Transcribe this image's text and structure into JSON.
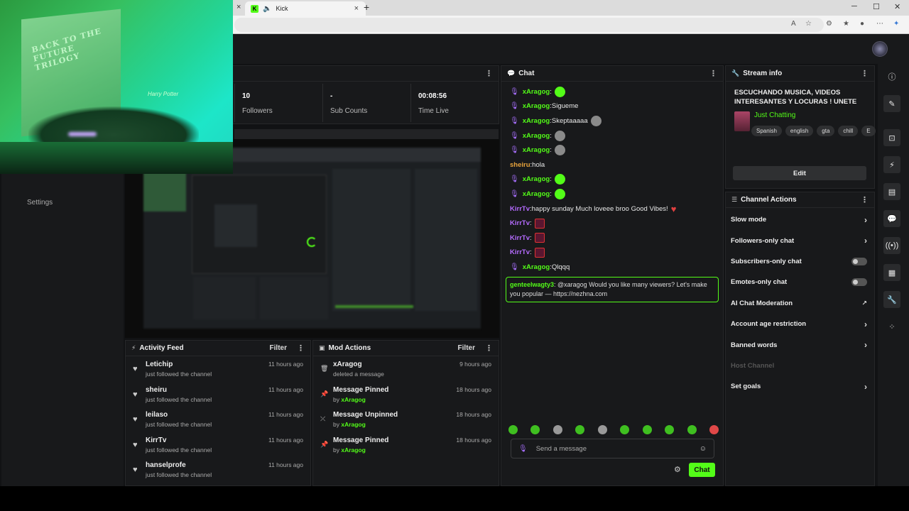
{
  "browser": {
    "tab_title": "Kick",
    "tab_favicon": "K",
    "new_tab": "+",
    "close": "×",
    "min": "─",
    "max": "☐",
    "wclose": "✕"
  },
  "stats": [
    {
      "value": "10",
      "label": "Followers"
    },
    {
      "value": "-",
      "label": "Sub Counts"
    },
    {
      "value": "00:08:56",
      "label": "Time Live"
    }
  ],
  "webcam": {
    "box_text": "BACK TO THE FUTURE TRILOGY",
    "hp_text": "Harry Potter"
  },
  "settings_label": "Settings",
  "activity_feed": {
    "title": "Activity Feed",
    "filter": "Filter",
    "items": [
      {
        "name": "Letichip",
        "sub": "just followed the channel",
        "ago": "11 hours ago"
      },
      {
        "name": "sheiru",
        "sub": "just followed the channel",
        "ago": "11 hours ago"
      },
      {
        "name": "leilaso",
        "sub": "just followed the channel",
        "ago": "11 hours ago"
      },
      {
        "name": "KirrTv",
        "sub": "just followed the channel",
        "ago": "11 hours ago"
      },
      {
        "name": "hanselprofe",
        "sub": "just followed the channel",
        "ago": "11 hours ago"
      }
    ]
  },
  "mod_actions": {
    "title": "Mod Actions",
    "filter": "Filter",
    "items": [
      {
        "icon": "trash-icon",
        "name": "xAragog",
        "sub": "deleted a message",
        "by": "",
        "ago": "9 hours ago"
      },
      {
        "icon": "pin-icon",
        "name": "Message Pinned",
        "sub": "by ",
        "by": "xAragog",
        "ago": "18 hours ago"
      },
      {
        "icon": "unpin-icon",
        "name": "Message Unpinned",
        "sub": "by ",
        "by": "xAragog",
        "ago": "18 hours ago"
      },
      {
        "icon": "pin-icon",
        "name": "Message Pinned",
        "sub": "by ",
        "by": "xAragog",
        "ago": "18 hours ago"
      }
    ]
  },
  "chat": {
    "title": "Chat",
    "messages": [
      {
        "mic": true,
        "user": "xAragog",
        "color": "x",
        "sep": ":",
        "text": "",
        "emote": "green"
      },
      {
        "mic": true,
        "user": "xAragog",
        "color": "x",
        "sep": ":",
        "text": " Sigueme",
        "emote": ""
      },
      {
        "mic": true,
        "user": "xAragog",
        "color": "x",
        "sep": ":",
        "text": " Skeptaaaaa",
        "emote": "gray"
      },
      {
        "mic": true,
        "user": "xAragog",
        "color": "x",
        "sep": ":",
        "text": "",
        "emote": "gray"
      },
      {
        "mic": true,
        "user": "xAragog",
        "color": "x",
        "sep": ":",
        "text": "",
        "emote": "gray"
      },
      {
        "mic": false,
        "user": "sheiru",
        "color": "s",
        "sep": ":",
        "text": " hola",
        "emote": ""
      },
      {
        "mic": true,
        "user": "xAragog",
        "color": "x",
        "sep": ":",
        "text": "",
        "emote": "green"
      },
      {
        "mic": true,
        "user": "xAragog",
        "color": "x",
        "sep": ":",
        "text": "",
        "emote": "green"
      },
      {
        "mic": false,
        "user": "KirrTv",
        "color": "k",
        "sep": ":",
        "text": " happy sunday Much loveee broo Good Vibes!",
        "emote": "heart"
      },
      {
        "mic": false,
        "user": "KirrTv",
        "color": "k",
        "sep": ":",
        "text": "",
        "emote": "red"
      },
      {
        "mic": false,
        "user": "KirrTv",
        "color": "k",
        "sep": ":",
        "text": "",
        "emote": "red"
      },
      {
        "mic": false,
        "user": "KirrTv",
        "color": "k",
        "sep": ":",
        "text": "",
        "emote": "red"
      },
      {
        "mic": true,
        "user": "xAragog",
        "color": "x",
        "sep": ":",
        "text": " Qlqqq",
        "emote": ""
      }
    ],
    "flagged": {
      "user": "genteelwagty3",
      "text": ": @xaragog Would you like many viewers? Let's make you popular — https://nezhna.com"
    },
    "input_placeholder": "Send a message",
    "send_label": "Chat"
  },
  "stream_info": {
    "title": "Stream info",
    "stream_title": "ESCUCHANDO MUSICA, VIDEOS INTERESANTES Y LOCURAS ! UNETE Y...",
    "category": "Just Chatting",
    "tags": [
      "Spanish",
      "english",
      "gta",
      "chill",
      "E"
    ],
    "edit_label": "Edit"
  },
  "channel_actions": {
    "title": "Channel Actions",
    "items": [
      {
        "label": "Slow mode",
        "kind": "chevron",
        "disabled": false
      },
      {
        "label": "Followers-only chat",
        "kind": "chevron",
        "disabled": false
      },
      {
        "label": "Subscribers-only chat",
        "kind": "toggle",
        "disabled": false
      },
      {
        "label": "Emotes-only chat",
        "kind": "toggle",
        "disabled": false
      },
      {
        "label": "AI Chat Moderation",
        "kind": "external",
        "disabled": false
      },
      {
        "label": "Account age restriction",
        "kind": "chevron",
        "disabled": false
      },
      {
        "label": "Banned words",
        "kind": "chevron",
        "disabled": false
      },
      {
        "label": "Host Channel",
        "kind": "none",
        "disabled": true
      },
      {
        "label": "Set goals",
        "kind": "chevron",
        "disabled": false
      }
    ]
  },
  "colors": {
    "accent": "#53fc18",
    "panel": "#18191b",
    "bg": "#111214"
  }
}
